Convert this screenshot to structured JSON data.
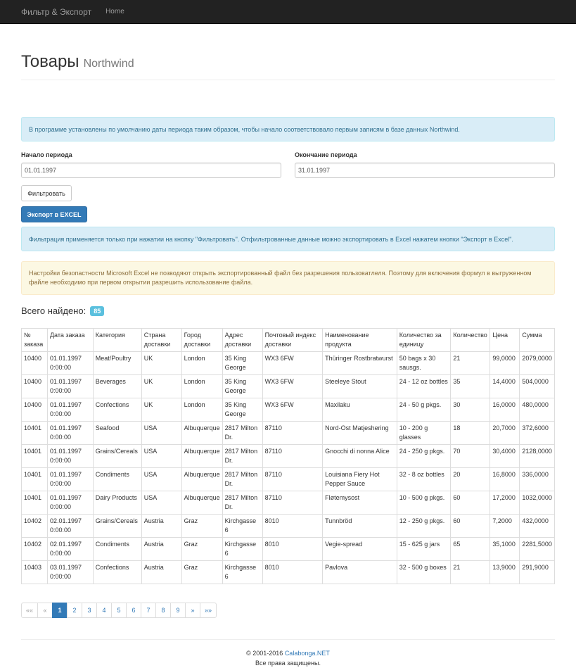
{
  "navbar": {
    "brand": "Фильтр & Экспорт",
    "home": "Home"
  },
  "header": {
    "title": "Товары",
    "subtitle": "Northwind"
  },
  "info_alert": "В программе установлены по умолчанию даты периода таким образом, чтобы начало соответствовало первым записям в базе данных Northwind.",
  "filter": {
    "start_label": "Начало периода",
    "start_value": "01.01.1997",
    "end_label": "Окончание периода",
    "end_value": "31.01.1997",
    "filter_button": "Фильтровать",
    "export_button": "Экспорт в EXCEL"
  },
  "filter_info": "Фильтрация применяется только при нажатии на кнопку \"Фильтровать\". Отфильтрованные данные можно экспортировать в Excel нажатем кнопки \"Экспорт в Excel\".",
  "warning_alert": "Настройки безопастности Microsoft Excel не позводяют открыть экспортированный файл без разрешения пользоватлеля. Поэтому для включения формул в выгруженном файле необходимо при первом открытии разрешить использование файла.",
  "summary": {
    "label": "Всего найдено:",
    "count": "85"
  },
  "table": {
    "columns": [
      "№ заказа",
      "Дата заказа",
      "Категория",
      "Страна доставки",
      "Город доставки",
      "Адрес доставки",
      "Почтовый индекс доставки",
      "Наименование продукта",
      "Количество за единицу",
      "Количество",
      "Цена",
      "Сумма"
    ],
    "rows": [
      [
        "10400",
        "01.01.1997 0:00:00",
        "Meat/Poultry",
        "UK",
        "London",
        "35 King George",
        "WX3 6FW",
        "Thüringer Rostbratwurst",
        "50 bags x 30 sausgs.",
        "21",
        "99,0000",
        "2079,0000"
      ],
      [
        "10400",
        "01.01.1997 0:00:00",
        "Beverages",
        "UK",
        "London",
        "35 King George",
        "WX3 6FW",
        "Steeleye Stout",
        "24 - 12 oz bottles",
        "35",
        "14,4000",
        "504,0000"
      ],
      [
        "10400",
        "01.01.1997 0:00:00",
        "Confections",
        "UK",
        "London",
        "35 King George",
        "WX3 6FW",
        "Maxilaku",
        "24 - 50 g pkgs.",
        "30",
        "16,0000",
        "480,0000"
      ],
      [
        "10401",
        "01.01.1997 0:00:00",
        "Seafood",
        "USA",
        "Albuquerque",
        "2817 Milton Dr.",
        "87110",
        "Nord-Ost Matjeshering",
        "10 - 200 g glasses",
        "18",
        "20,7000",
        "372,6000"
      ],
      [
        "10401",
        "01.01.1997 0:00:00",
        "Grains/Cereals",
        "USA",
        "Albuquerque",
        "2817 Milton Dr.",
        "87110",
        "Gnocchi di nonna Alice",
        "24 - 250 g pkgs.",
        "70",
        "30,4000",
        "2128,0000"
      ],
      [
        "10401",
        "01.01.1997 0:00:00",
        "Condiments",
        "USA",
        "Albuquerque",
        "2817 Milton Dr.",
        "87110",
        "Louisiana Fiery Hot Pepper Sauce",
        "32 - 8 oz bottles",
        "20",
        "16,8000",
        "336,0000"
      ],
      [
        "10401",
        "01.01.1997 0:00:00",
        "Dairy Products",
        "USA",
        "Albuquerque",
        "2817 Milton Dr.",
        "87110",
        "Fløtemysost",
        "10 - 500 g pkgs.",
        "60",
        "17,2000",
        "1032,0000"
      ],
      [
        "10402",
        "02.01.1997 0:00:00",
        "Grains/Cereals",
        "Austria",
        "Graz",
        "Kirchgasse 6",
        "8010",
        "Tunnbröd",
        "12 - 250 g pkgs.",
        "60",
        "7,2000",
        "432,0000"
      ],
      [
        "10402",
        "02.01.1997 0:00:00",
        "Condiments",
        "Austria",
        "Graz",
        "Kirchgasse 6",
        "8010",
        "Vegie-spread",
        "15 - 625 g jars",
        "65",
        "35,1000",
        "2281,5000"
      ],
      [
        "10403",
        "03.01.1997 0:00:00",
        "Confections",
        "Austria",
        "Graz",
        "Kirchgasse 6",
        "8010",
        "Pavlova",
        "32 - 500 g boxes",
        "21",
        "13,9000",
        "291,9000"
      ]
    ]
  },
  "pagination": {
    "first": "««",
    "prev": "«",
    "pages": [
      "1",
      "2",
      "3",
      "4",
      "5",
      "6",
      "7",
      "8",
      "9"
    ],
    "active": "1",
    "next": "»",
    "last": "»»"
  },
  "footer": {
    "copyright": "© 2001-2016",
    "company": "Calabonga.NET",
    "rights": "Все права защищены."
  },
  "colors": {
    "primary": "#337ab7",
    "info_bg": "#d9edf7",
    "warning_bg": "#fcf8e3",
    "badge": "#5bc0de",
    "navbar": "#222222"
  }
}
